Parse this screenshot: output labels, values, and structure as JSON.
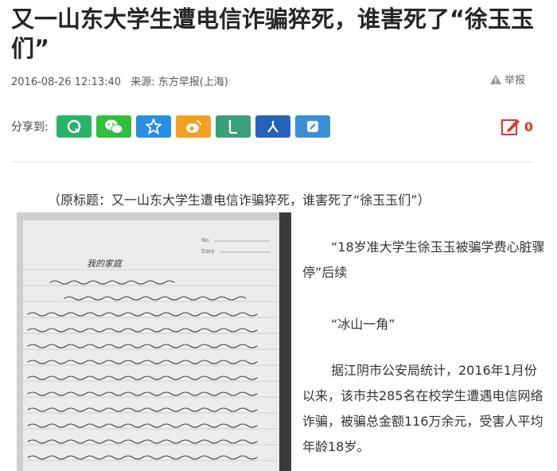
{
  "article": {
    "title": "又一山东大学生遭电信诈骗猝死，谁害死了“徐玉玉们”",
    "date": "2016-08-26 12:13:40",
    "source": "来源: 东方早报(上海)",
    "report_label": "举报",
    "comment_count": "0",
    "original_title": "（原标题：又一山东大学生遭电信诈骗猝死，谁害死了“徐玉玉们”）",
    "paragraphs": [
      "“18岁准大学生徐玉玉被骗学费心脏骤停”后续",
      "“冰山一角”",
      "据江阴市公安局统计，2016年1月份以来，该市共285名在校学生遭遇电信网络诈骗，被骗总金额116万余元，受害人平均年龄18岁。"
    ]
  },
  "share": {
    "label": "分享到:",
    "buttons": [
      {
        "icon": "qq-icon",
        "color": "#27b36a"
      },
      {
        "icon": "wechat-icon",
        "color": "#2fbf3c"
      },
      {
        "icon": "qzone-star-icon",
        "color": "#2a8ee6"
      },
      {
        "icon": "weibo-icon",
        "color": "#f2a01e"
      },
      {
        "icon": "renren-icon",
        "color": "#3aa07a"
      },
      {
        "icon": "people-icon",
        "color": "#2563b8"
      },
      {
        "icon": "copy-link-icon",
        "color": "#3a8ed8"
      }
    ]
  },
  "photo": {
    "notebook_header": "我的家庭",
    "field_labels": [
      "No.",
      "Date"
    ]
  }
}
